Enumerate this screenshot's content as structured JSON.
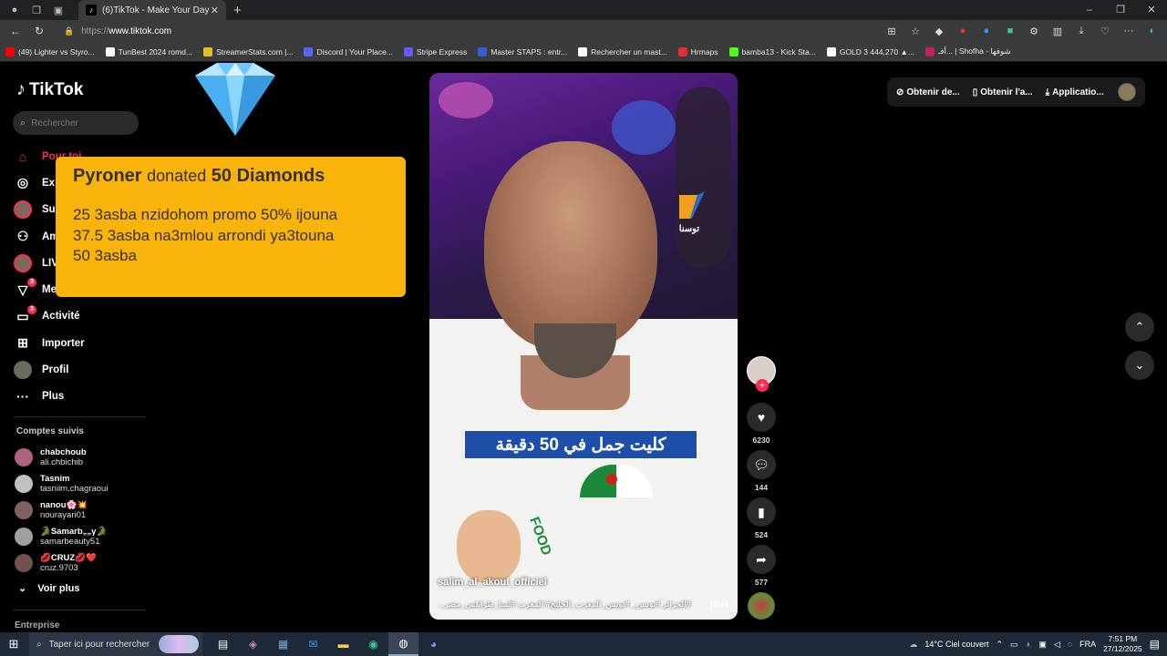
{
  "browser": {
    "tab_title": "(6)TikTok - Make Your Day",
    "url_proto": "https://",
    "url_host": "www.tiktok.com",
    "bookmarks": [
      {
        "label": "(49) Lighter vs Styro...",
        "color": "#ff0000"
      },
      {
        "label": "TunBest 2024 romd...",
        "color": "#ffffff"
      },
      {
        "label": "StreamerStats.com |...",
        "color": "#e0c020"
      },
      {
        "label": "Discord | Your Place...",
        "color": "#5865f2"
      },
      {
        "label": "Stripe Express",
        "color": "#635bff"
      },
      {
        "label": "Master STAPS : entr...",
        "color": "#3a5ad0"
      },
      {
        "label": "Rechercher un mast...",
        "color": "#ffffff"
      },
      {
        "label": "Hrmaps",
        "color": "#e03030"
      },
      {
        "label": "bamba13 - Kick Sta...",
        "color": "#53fc18"
      },
      {
        "label": "GOLD 3 444,270 ▲...",
        "color": "#ffffff"
      },
      {
        "label": "أفـ... | Shofha - شوفها",
        "color": "#c02060"
      }
    ]
  },
  "tiktok": {
    "brand": "TikTok",
    "search_placeholder": "Rechercher",
    "nav": [
      {
        "label": "Pour toi",
        "icon": "home-icon",
        "glyph": "⌂",
        "active": true,
        "name": "nav-pour-toi"
      },
      {
        "label": "Explorer",
        "icon": "compass-icon",
        "glyph": "◎",
        "name": "nav-explorer"
      },
      {
        "label": "Suivis",
        "icon": "avatar",
        "glyph": "",
        "name": "nav-suivis"
      },
      {
        "label": "Amis",
        "icon": "friends-icon",
        "glyph": "⚇",
        "name": "nav-amis"
      },
      {
        "label": "LIVE",
        "icon": "live-icon",
        "glyph": "",
        "name": "nav-live"
      },
      {
        "label": "Messages",
        "icon": "messages-icon",
        "glyph": "▽",
        "badge": "3",
        "name": "nav-messages"
      },
      {
        "label": "Activité",
        "icon": "activity-icon",
        "glyph": "▭",
        "badge": "3",
        "name": "nav-activite"
      },
      {
        "label": "Importer",
        "icon": "upload-icon",
        "glyph": "⊞",
        "name": "nav-importer"
      },
      {
        "label": "Profil",
        "icon": "profile-avatar",
        "glyph": "",
        "name": "nav-profil"
      },
      {
        "label": "Plus",
        "icon": "more-icon",
        "glyph": "···",
        "name": "nav-plus"
      }
    ],
    "following_title": "Comptes suivis",
    "following": [
      {
        "name": "chabchoub",
        "handle": "ali.chbichib",
        "color": "#b06080"
      },
      {
        "name": "Tasnim",
        "handle": "tasniim.chagraoui",
        "color": "#c0c0c0"
      },
      {
        "name": "nanou🌸💥",
        "handle": "nourayari01",
        "color": "#806060"
      },
      {
        "name": "🐊Samarb„„γ🐊",
        "handle": "samarbeauty51",
        "color": "#a0a0a0"
      },
      {
        "name": "💋CRUZ💋❤️",
        "handle": "cruz.9703",
        "color": "#705050"
      }
    ],
    "see_more": "Voir plus",
    "entreprise": "Entreprise",
    "top_right": {
      "item1": "Obtenir de...",
      "item2": "Obtenir l'a...",
      "item3": "Applicatio..."
    }
  },
  "donation": {
    "donor": "Pyroner",
    "verb": "donated",
    "amount": "50 Diamonds",
    "line1": "25 3asba nzidohom promo 50% ijouna",
    "line2": "37.5 3asba na3mlou arrondi ya3touna",
    "line3": "50 3asba"
  },
  "video": {
    "channel_logo_text": "توسنا",
    "caption": "كليت جمل في 50 دقيقة",
    "sticker_text": "FOOD",
    "username": "salim_al_akoul_officiel",
    "hashtags": "#الجزائر #تونس_ #تونس_المغرب_الخليج# المغرب #لبيبا_طرابلس_مصر...",
    "more": "plus",
    "likes": "6230",
    "comments": "144",
    "saves": "524",
    "shares": "577"
  },
  "taskbar": {
    "search_placeholder": "Taper ici pour rechercher",
    "weather": "14°C  Ciel couvert",
    "lang": "FRA",
    "time": "7:51 PM",
    "date": "27/12/2025"
  }
}
